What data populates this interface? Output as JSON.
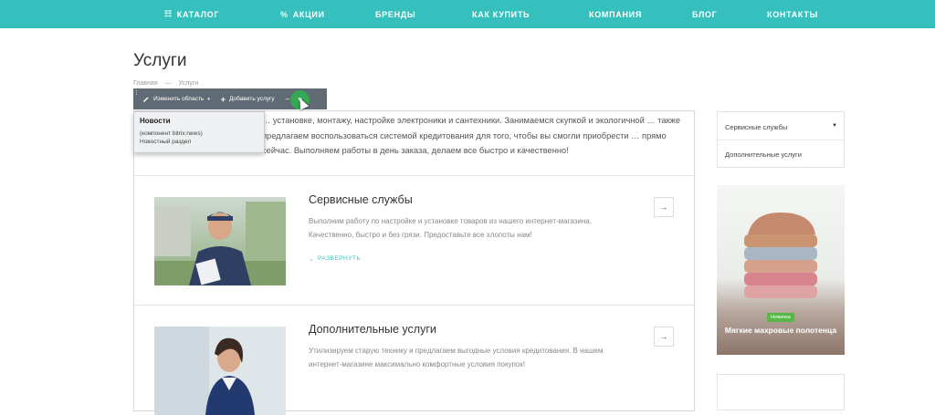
{
  "topnav": {
    "items": [
      {
        "label": "КАТАЛОГ",
        "icon": "grid-icon"
      },
      {
        "label": "АКЦИИ",
        "icon": "percent-icon"
      },
      {
        "label": "БРЕНДЫ"
      },
      {
        "label": "КАК КУПИТЬ"
      },
      {
        "label": "КОМПАНИЯ"
      },
      {
        "label": "БЛОГ"
      },
      {
        "label": "КОНТАКТЫ"
      }
    ]
  },
  "page": {
    "title": "Услуги",
    "breadcrumb": [
      "Главная",
      "—",
      "Услуги"
    ],
    "intro": "… установке, монтажу, настройке электроники и сантехники. Занимаемся скупкой и экологичной … также предлагаем воспользоваться системой кредитования для того, чтобы вы смогли приобрести … прямо сейчас. Выполняем работы в день заказа, делаем все быстро и качественно!"
  },
  "editbar": {
    "change_area": "Изменить область",
    "add_service": "Добавить услугу"
  },
  "popup": {
    "title": "Новости",
    "line1": "(компонент bitrix:news)",
    "line2": "Новостный раздел"
  },
  "services": [
    {
      "title": "Сервисные службы",
      "desc": "Выполним работу по настройке и установке товаров из нашего интернет-магазина. Качественно, быстро и без грязи. Предоставьте все хлопоты нам!",
      "expand": "РАЗВЕРНУТЬ"
    },
    {
      "title": "Дополнительные услуги",
      "desc": "Утилизируем старую технику и предлагаем выгодные условия кредитования. В нашем интернет-магазине максимально комфортные условия покупок!"
    }
  ],
  "sidebar": {
    "items": [
      "Сервисные службы",
      "Дополнительные услуги"
    ]
  },
  "promo": {
    "badge": "Новинка",
    "title": "Мягкие махровые полотенца"
  },
  "colors": {
    "accent": "#35bfbd",
    "green": "#34a853",
    "badge": "#57b845"
  }
}
